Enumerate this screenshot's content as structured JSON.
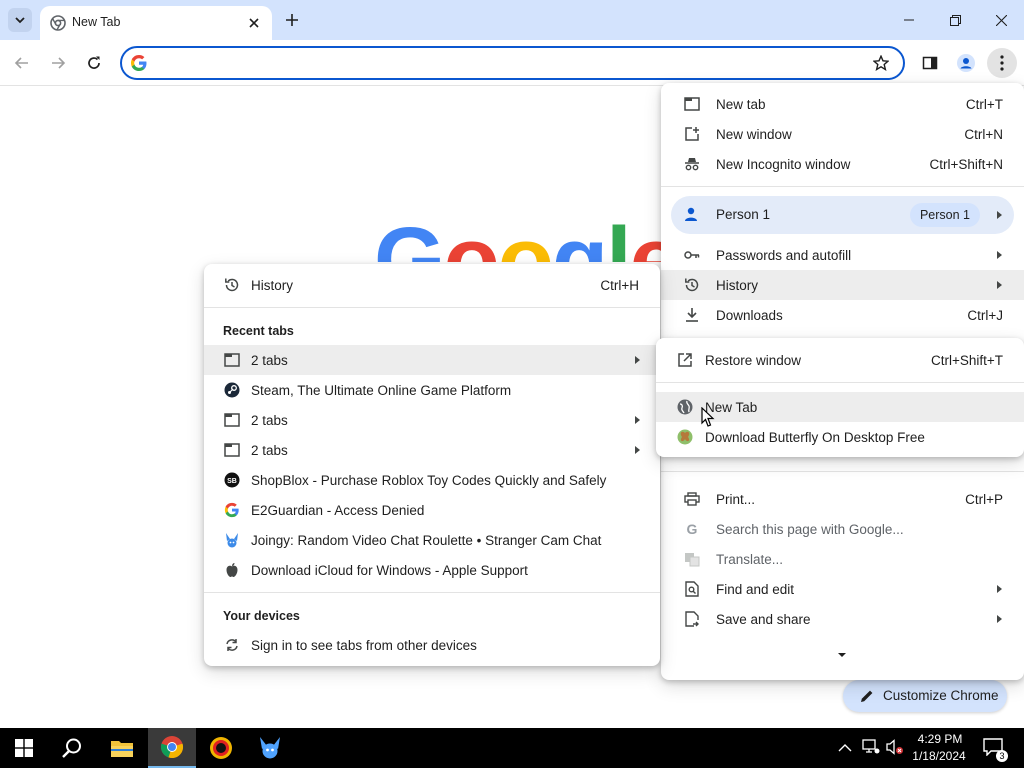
{
  "browser": {
    "tab_title": "New Tab",
    "omnibox_value": "",
    "omnibox_placeholder": ""
  },
  "page": {
    "logo_text": "Google",
    "customize_label": "Customize Chrome"
  },
  "main_menu": {
    "new_tab": "New tab",
    "new_tab_sc": "Ctrl+T",
    "new_window": "New window",
    "new_window_sc": "Ctrl+N",
    "incognito": "New Incognito window",
    "incognito_sc": "Ctrl+Shift+N",
    "person": "Person 1",
    "person_badge": "Person 1",
    "passwords": "Passwords and autofill",
    "history": "History",
    "downloads": "Downloads",
    "downloads_sc": "Ctrl+J",
    "print": "Print...",
    "print_sc": "Ctrl+P",
    "search_page": "Search this page with Google...",
    "translate": "Translate...",
    "find_edit": "Find and edit",
    "save_share": "Save and share"
  },
  "history_menu": {
    "history": "History",
    "history_sc": "Ctrl+H",
    "recent_tabs_title": "Recent tabs",
    "items": [
      {
        "label": "2 tabs"
      },
      {
        "label": "Steam, The Ultimate Online Game Platform"
      },
      {
        "label": "2 tabs"
      },
      {
        "label": "2 tabs"
      },
      {
        "label": "ShopBlox - Purchase Roblox Toy Codes Quickly and Safely"
      },
      {
        "label": "E2Guardian - Access Denied"
      },
      {
        "label": "Joingy: Random Video Chat Roulette • Stranger Cam Chat"
      },
      {
        "label": "Download iCloud for Windows - Apple Support"
      }
    ],
    "devices_title": "Your devices",
    "sign_in": "Sign in to see tabs from other devices"
  },
  "tabs_menu": {
    "restore": "Restore window",
    "restore_sc": "Ctrl+Shift+T",
    "items": [
      {
        "label": "New Tab"
      },
      {
        "label": "Download Butterfly On Desktop Free"
      }
    ]
  },
  "taskbar": {
    "time": "4:29 PM",
    "date": "1/18/2024",
    "notifications": "3"
  },
  "colors": {
    "accent": "#0b57d0",
    "tabstrip": "#d3e3fd",
    "menu_highlight": "#ededed"
  }
}
